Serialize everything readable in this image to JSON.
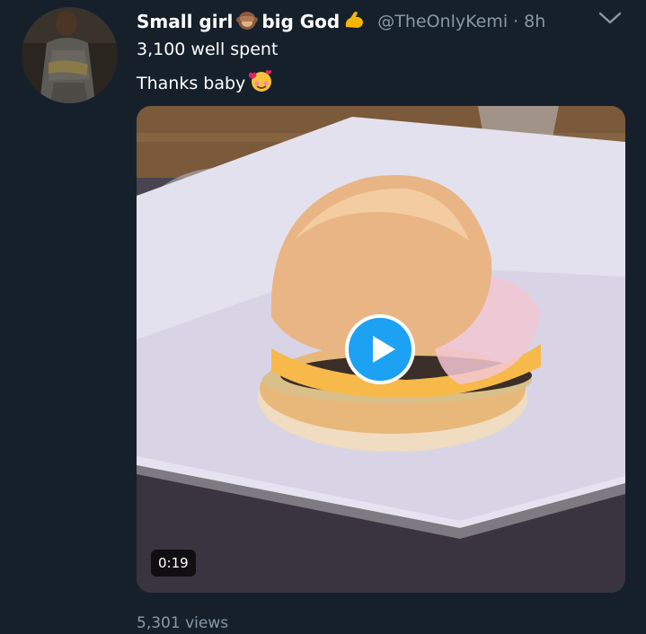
{
  "tweet": {
    "display_name": "Small girl",
    "display_name_suffix": "big God",
    "handle": "@TheOnlyKemi",
    "separator": "·",
    "time": "8h",
    "lines": [
      "3,100 well spent",
      "Thanks baby"
    ],
    "icons": {
      "name_emoji_1": "see-no-evil-monkey-icon",
      "name_emoji_2": "flexed-biceps-icon",
      "text_emoji": "smiling-face-with-hearts-icon",
      "menu": "chevron-down-icon",
      "media_action": "play-icon"
    },
    "media": {
      "duration": "0:19"
    },
    "views": "5,301 views"
  },
  "colors": {
    "background": "#15202b",
    "secondary_text": "#8899a6",
    "play_button": "#1da1f2"
  }
}
